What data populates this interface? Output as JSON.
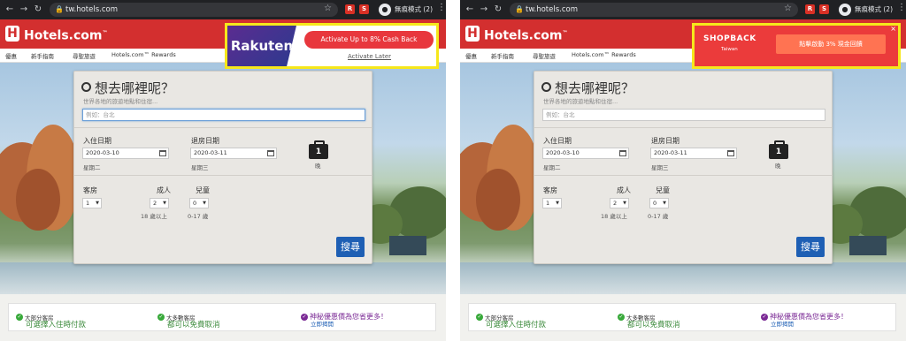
{
  "browser": {
    "url": "tw.hotels.com",
    "incognito_label": "無痕模式 (2)",
    "ext1": "R",
    "ext2": "S"
  },
  "site": {
    "logo": "Hotels.com",
    "logo_tm": "™",
    "subnav": [
      "優惠",
      "新手指南",
      "尋聖旅遊",
      "Hotels.com™ Rewards"
    ]
  },
  "search": {
    "title": "想去哪裡呢？",
    "subtitle": "世界各地的旅遊地點和住宿...",
    "destination_placeholder": "例如：台北",
    "checkin_label": "入住日期",
    "checkout_label": "退房日期",
    "checkin_value": "2020-03-10",
    "checkout_value": "2020-03-11",
    "checkin_day": "星期二",
    "checkout_day": "星期三",
    "nights": "1",
    "nights_label": "晚",
    "rooms_label": "客房",
    "adults_label": "成人",
    "children_label": "兒童",
    "rooms_value": "1",
    "adults_value": "2",
    "children_value": "0",
    "adults_hint": "18 歲以上",
    "children_hint": "0-17 歲",
    "search_button": "搜尋"
  },
  "benefits": [
    {
      "small": "大部分客房",
      "main": "可選擇入住時付款"
    },
    {
      "small": "大多數客房",
      "main": "都可以免費取消"
    },
    {
      "main": "神秘優惠價為您省更多！",
      "link": "立即揭開"
    }
  ],
  "rakuten": {
    "brand": "Rakuten",
    "button": "Activate Up to 8% Cash Back",
    "later": "Activate Later"
  },
  "shopback": {
    "brand": "SHOPBACK",
    "region": "Taiwan",
    "button": "點擊啟動 3% 現金回饋",
    "close": "×"
  }
}
